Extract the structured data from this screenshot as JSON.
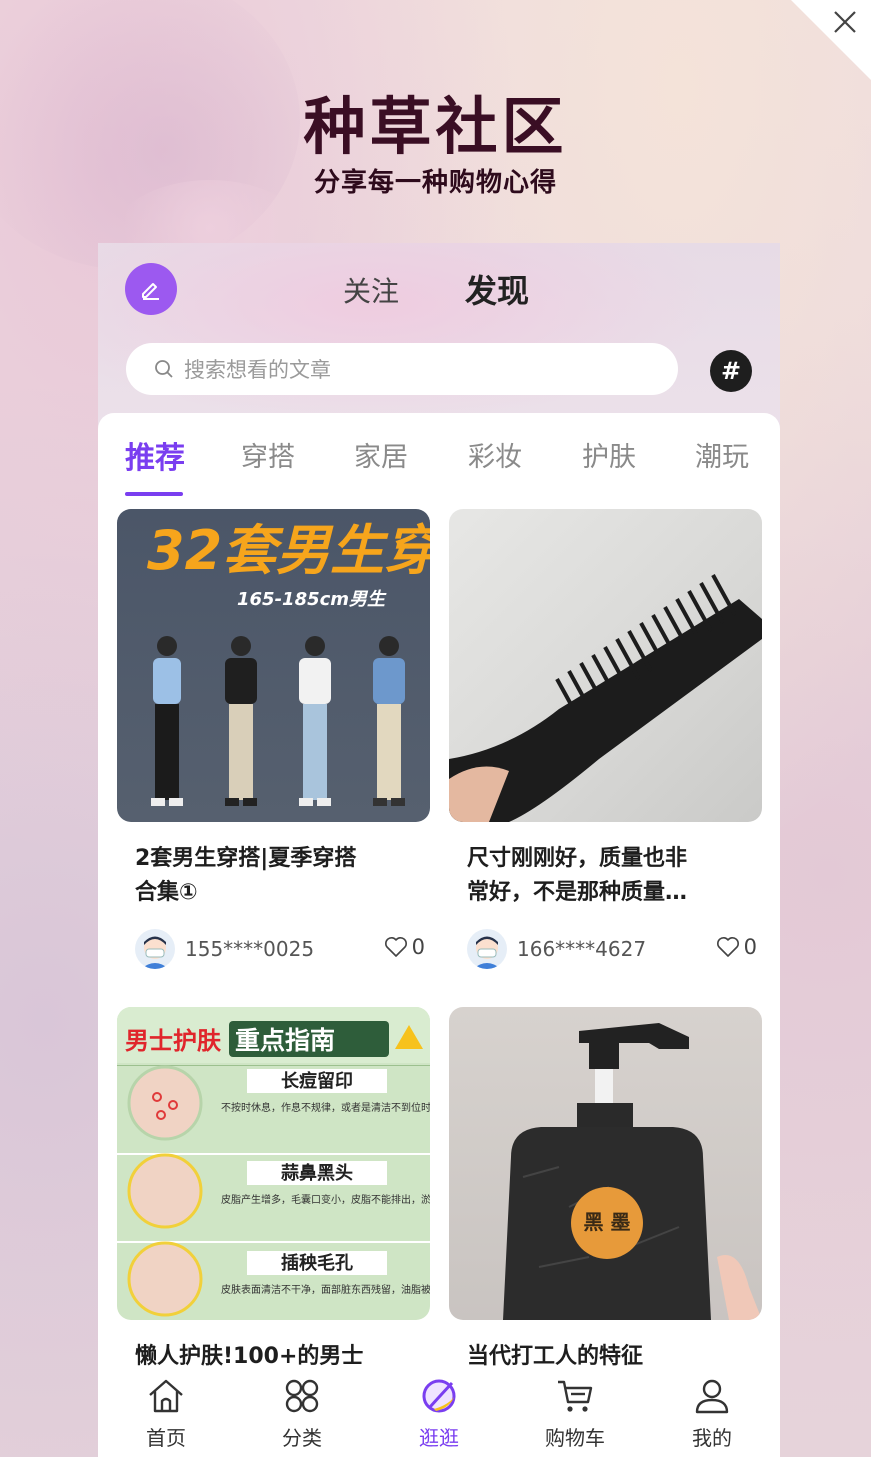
{
  "hero": {
    "title": "种草社区",
    "subtitle": "分享每一种购物心得"
  },
  "tabs": {
    "follow": "关注",
    "discover": "发现",
    "active": "discover"
  },
  "search": {
    "placeholder": "搜索想看的文章",
    "hash_icon": "hash-icon"
  },
  "categories": [
    {
      "label": "推荐",
      "active": true
    },
    {
      "label": "穿搭",
      "active": false
    },
    {
      "label": "家居",
      "active": false
    },
    {
      "label": "彩妆",
      "active": false
    },
    {
      "label": "护肤",
      "active": false
    },
    {
      "label": "潮玩",
      "active": false
    }
  ],
  "posts": [
    {
      "image_title": "32套男生穿",
      "image_sub": "165-185cm男生",
      "title_line1": "2套男生穿搭|夏季穿搭",
      "title_line2": "合集①",
      "user": "155****0025",
      "likes": "0"
    },
    {
      "title_line1": "尺寸刚刚好，质量也非",
      "title_line2": "常好，不是那种质量…",
      "user": "166****4627",
      "likes": "0"
    },
    {
      "image_header_red": "男士护肤",
      "image_header_blk": "重点指南",
      "image_sections": [
        {
          "head": "长痘留印",
          "body": "不按时休息，作息不规律，或者是清洁不到位时，早上面部出油爆痘。"
        },
        {
          "head": "蒜鼻黑头",
          "body": "皮脂产生增多，毛囊口变小，皮脂不能排出，淤积在毛囊口，形成黑头。"
        },
        {
          "head": "插秧毛孔",
          "body": "皮肤表面清洁不干净，面部脏东西残留，油脂被堵塞在毛孔里"
        }
      ],
      "title_line1": "懒人护肤!100+的男士"
    },
    {
      "bottle_label": "黑 墨",
      "title_line1": "当代打工人的特征"
    }
  ],
  "nav": [
    {
      "label": "首页",
      "icon": "home-icon",
      "active": false
    },
    {
      "label": "分类",
      "icon": "category-icon",
      "active": false
    },
    {
      "label": "逛逛",
      "icon": "explore-icon",
      "active": true
    },
    {
      "label": "购物车",
      "icon": "cart-icon",
      "active": false
    },
    {
      "label": "我的",
      "icon": "profile-icon",
      "active": false
    }
  ],
  "colors": {
    "accent": "#7a3ef0",
    "edit_button": "#9c59f0",
    "title_dark": "#3a0e24"
  }
}
